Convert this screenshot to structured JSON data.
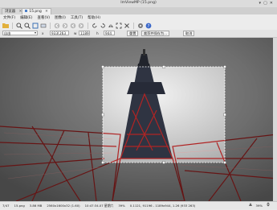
{
  "window": {
    "title": "ImViewMP (15.png)",
    "controls": [
      "▾",
      "▢",
      "✕"
    ]
  },
  "tabs": [
    {
      "label": "浏览器",
      "close": "✕"
    },
    {
      "label": "15.png",
      "close": "✕"
    }
  ],
  "menu": [
    "文件(F)",
    "编辑(E)",
    "查看(V)",
    "图像(I)",
    "工具(T)",
    "帮助(H)"
  ],
  "options": {
    "preset": "自由",
    "x": "933",
    "y": "263",
    "width": "1189",
    "height": "944",
    "reset": "重置",
    "crop_save_as": "裁剪并保存为...",
    "cancel": "取消"
  },
  "status": {
    "index": "7/47",
    "filename": "15.png",
    "filesize": "3.86 MB",
    "dimensions": "2560x1600x32 (1.60)",
    "date": "10:47:34.07 星期六",
    "zoom_info": "39%",
    "coords": "0.1121, 91196 - 1189x944, 1.26 (933 263)",
    "zoom": "39%"
  }
}
